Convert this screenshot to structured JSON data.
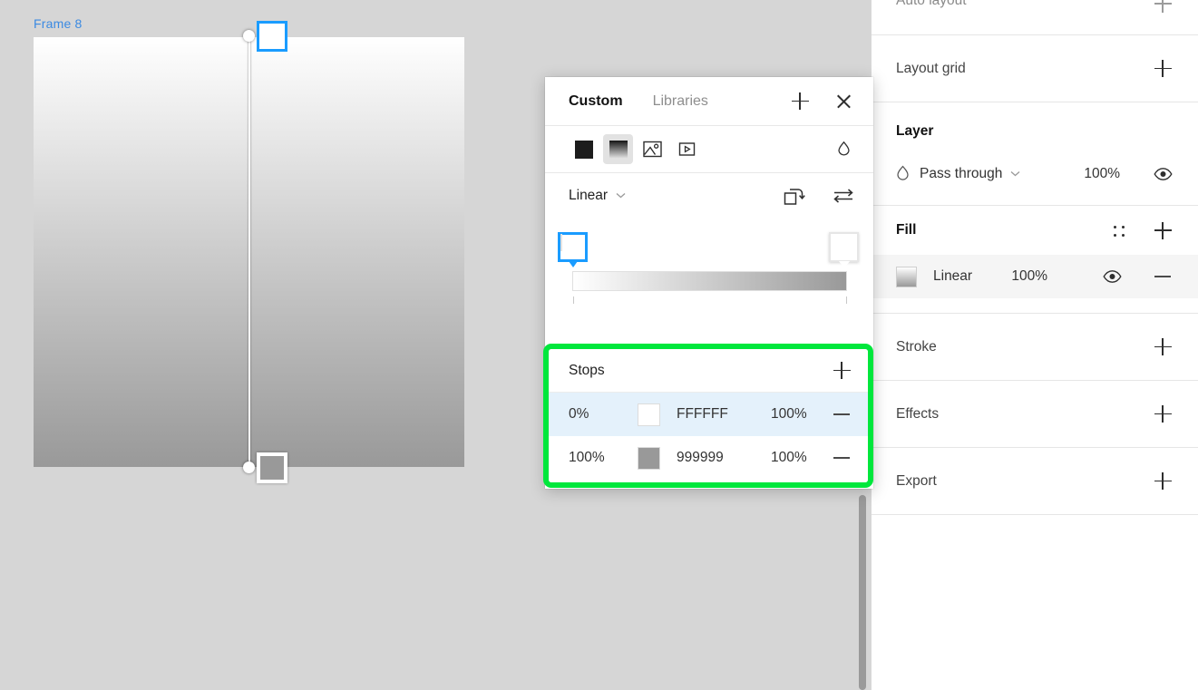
{
  "canvas": {
    "frame_label": "Frame 8",
    "background_color": "#d6d6d6",
    "frame_gradient_start": "#FFFFFF",
    "frame_gradient_end": "#999999",
    "handle_selected_color": "#1a9cff"
  },
  "picker": {
    "tabs": {
      "custom": "Custom",
      "libraries": "Libraries"
    },
    "add_label": "+",
    "close_label": "×",
    "types": {
      "solid": "solid-fill",
      "gradient": "gradient-fill",
      "image": "image-fill",
      "video": "video-fill",
      "eyedropper": "eyedropper"
    },
    "mode": "Linear",
    "gradient_start": "#FFFFFF",
    "gradient_end": "#999999"
  },
  "stops": {
    "title": "Stops",
    "add_label": "+",
    "highlight_color": "#00e73c",
    "rows": [
      {
        "position": "0%",
        "hex": "FFFFFF",
        "color": "#FFFFFF",
        "opacity": "100%",
        "selected": true
      },
      {
        "position": "100%",
        "hex": "999999",
        "color": "#999999",
        "opacity": "100%",
        "selected": false
      }
    ]
  },
  "right_panel": {
    "auto_layout": {
      "title": "Auto layout"
    },
    "layout_grid": {
      "title": "Layout grid"
    },
    "layer": {
      "title": "Layer",
      "blend_mode": "Pass through",
      "opacity": "100%"
    },
    "fill": {
      "title": "Fill",
      "item_name": "Linear",
      "item_opacity": "100%"
    },
    "stroke": {
      "title": "Stroke"
    },
    "effects": {
      "title": "Effects"
    },
    "export": {
      "title": "Export"
    }
  }
}
